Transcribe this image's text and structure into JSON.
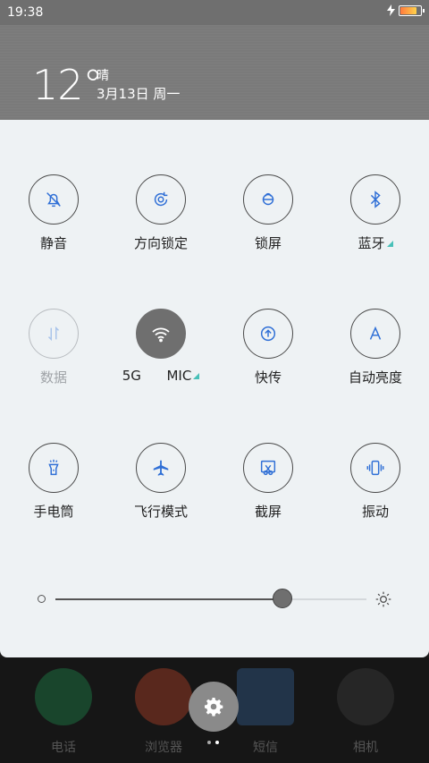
{
  "status": {
    "time": "19:38",
    "battery_level": 0.85
  },
  "weather": {
    "temperature": "12°",
    "condition": "晴",
    "date": "3月13日 周一"
  },
  "toggles": [
    {
      "label": "静音",
      "icon": "bell-off-icon",
      "state": "off"
    },
    {
      "label": "方向锁定",
      "icon": "rotation-lock-icon",
      "state": "off"
    },
    {
      "label": "锁屏",
      "icon": "lock-icon",
      "state": "off"
    },
    {
      "label": "蓝牙",
      "icon": "bluetooth-icon",
      "state": "off",
      "has_more": true
    },
    {
      "label": "数据",
      "icon": "data-arrows-icon",
      "state": "disabled"
    },
    {
      "label": "5G      MIC",
      "icon": "wifi-icon",
      "state": "on",
      "has_more": true
    },
    {
      "label": "快传",
      "icon": "fast-transfer-icon",
      "state": "off"
    },
    {
      "label": "自动亮度",
      "icon": "auto-brightness-icon",
      "state": "off"
    },
    {
      "label": "手电筒",
      "icon": "flashlight-icon",
      "state": "off"
    },
    {
      "label": "飞行模式",
      "icon": "airplane-icon",
      "state": "off"
    },
    {
      "label": "截屏",
      "icon": "screenshot-icon",
      "state": "off"
    },
    {
      "label": "振动",
      "icon": "vibrate-icon",
      "state": "off"
    }
  ],
  "brightness": {
    "value": 0.73
  },
  "dock": [
    {
      "label": "电话",
      "icon": "phone-icon",
      "color": "#1f9e57"
    },
    {
      "label": "浏览器",
      "icon": "browser-icon",
      "color": "#d84a2a"
    },
    {
      "label": "短信",
      "icon": "message-icon",
      "color": "#3a6ea8"
    },
    {
      "label": "相机",
      "icon": "camera-icon",
      "color": "#444444"
    }
  ],
  "colors": {
    "accent": "#2f6fd6",
    "panel": "#eef2f4",
    "teal": "#48c0b8"
  }
}
